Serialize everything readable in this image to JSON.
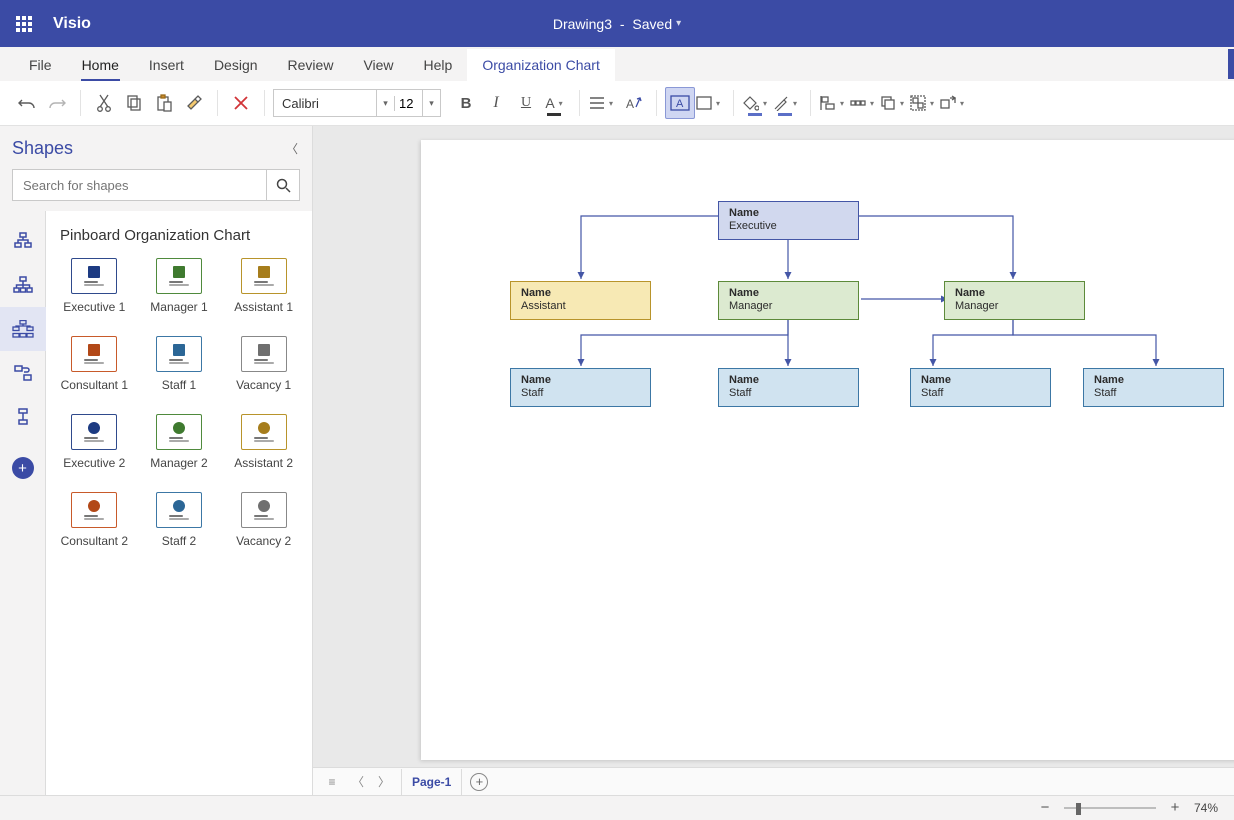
{
  "app": {
    "name": "Visio",
    "doc": "Drawing3",
    "status": "Saved"
  },
  "tabs": [
    "File",
    "Home",
    "Insert",
    "Design",
    "Review",
    "View",
    "Help",
    "Organization Chart"
  ],
  "toolbar": {
    "font": "Calibri",
    "size": "12"
  },
  "shapes": {
    "panel_title": "Shapes",
    "search_placeholder": "Search for shapes",
    "stencil_title": "Pinboard Organization Chart",
    "items": [
      "Executive 1",
      "Manager 1",
      "Assistant 1",
      "Consultant 1",
      "Staff 1",
      "Vacancy 1",
      "Executive 2",
      "Manager 2",
      "Assistant 2",
      "Consultant 2",
      "Staff 2",
      "Vacancy 2"
    ]
  },
  "org": {
    "name_label": "Name",
    "roles": {
      "executive": "Executive",
      "assistant": "Assistant",
      "manager": "Manager",
      "staff": "Staff"
    }
  },
  "page_tab": "Page-1",
  "zoom": "74%",
  "thumb_styles": [
    {
      "border": "#2f4a8c",
      "bg": "#ffffff",
      "badge": "#1d3b82",
      "badge_shape": "square"
    },
    {
      "border": "#4f8a3d",
      "bg": "#ffffff",
      "badge": "#3f7a2f",
      "badge_shape": "square"
    },
    {
      "border": "#b8942b",
      "bg": "#ffffff",
      "badge": "#a67d1c",
      "badge_shape": "square"
    },
    {
      "border": "#c85a2a",
      "bg": "#ffffff",
      "badge": "#b24817",
      "badge_shape": "square"
    },
    {
      "border": "#3c77a5",
      "bg": "#ffffff",
      "badge": "#2b6696",
      "badge_shape": "square"
    },
    {
      "border": "#888888",
      "bg": "#ffffff",
      "badge": "#6f6f6f",
      "badge_shape": "square"
    },
    {
      "border": "#2f4a8c",
      "bg": "#ffffff",
      "badge": "#1d3b82",
      "badge_shape": "circle"
    },
    {
      "border": "#4f8a3d",
      "bg": "#ffffff",
      "badge": "#3f7a2f",
      "badge_shape": "circle"
    },
    {
      "border": "#b8942b",
      "bg": "#ffffff",
      "badge": "#a67d1c",
      "badge_shape": "circle"
    },
    {
      "border": "#c85a2a",
      "bg": "#ffffff",
      "badge": "#b24817",
      "badge_shape": "circle"
    },
    {
      "border": "#3c77a5",
      "bg": "#ffffff",
      "badge": "#2b6696",
      "badge_shape": "circle"
    },
    {
      "border": "#888888",
      "bg": "#ffffff",
      "badge": "#6f6f6f",
      "badge_shape": "circle"
    }
  ]
}
